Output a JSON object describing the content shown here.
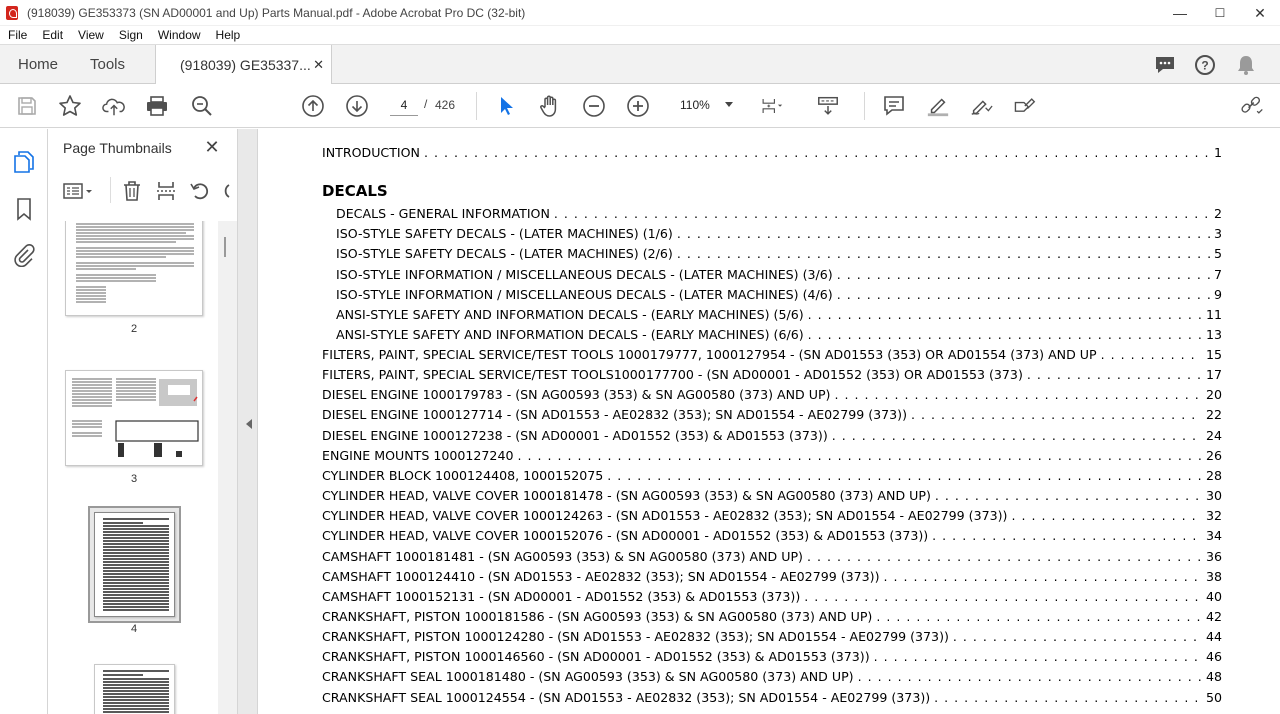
{
  "window": {
    "title": "(918039) GE353373 (SN AD00001 and Up) Parts Manual.pdf - Adobe Acrobat Pro DC (32-bit)",
    "minimize": "—",
    "maximize": "☐",
    "close": "✕"
  },
  "menu": [
    "File",
    "Edit",
    "View",
    "Sign",
    "Window",
    "Help"
  ],
  "tabs": {
    "home": "Home",
    "tools": "Tools",
    "document": "(918039) GE35337...",
    "document_close": "✕"
  },
  "toolbar": {
    "current_page": "4",
    "page_separator": "/",
    "total_pages": "426",
    "zoom": "110%"
  },
  "thumbnails": {
    "title": "Page Thumbnails",
    "close": "✕",
    "pages": [
      "2",
      "3",
      "4"
    ]
  },
  "toc": {
    "intro": {
      "title": "INTRODUCTION",
      "page": "1"
    },
    "section": "DECALS",
    "decal_entries": [
      {
        "title": "DECALS - GENERAL INFORMATION",
        "page": "2"
      },
      {
        "title": "ISO-STYLE SAFETY DECALS - (LATER MACHINES) (1/6)",
        "page": "3"
      },
      {
        "title": "ISO-STYLE SAFETY DECALS - (LATER MACHINES) (2/6)",
        "page": "5"
      },
      {
        "title": "ISO-STYLE INFORMATION / MISCELLANEOUS DECALS - (LATER MACHINES) (3/6)",
        "page": "7"
      },
      {
        "title": "ISO-STYLE INFORMATION / MISCELLANEOUS DECALS - (LATER MACHINES) (4/6)",
        "page": "9"
      },
      {
        "title": "ANSI-STYLE SAFETY AND INFORMATION DECALS - (EARLY MACHINES) (5/6)",
        "page": "11"
      },
      {
        "title": "ANSI-STYLE SAFETY AND INFORMATION DECALS - (EARLY MACHINES) (6/6)",
        "page": "13"
      }
    ],
    "entries": [
      {
        "title": "FILTERS, PAINT, SPECIAL SERVICE/TEST TOOLS 1000179777, 1000127954 - (SN AD01553 (353) OR AD01554 (373) AND UP",
        "page": "15"
      },
      {
        "title": "FILTERS, PAINT, SPECIAL SERVICE/TEST TOOLS1000177700 - (SN AD00001 - AD01552 (353) OR AD01553 (373)",
        "page": "17"
      },
      {
        "title": "DIESEL ENGINE 1000179783 - (SN AG00593 (353) & SN AG00580 (373) AND UP)",
        "page": "20"
      },
      {
        "title": "DIESEL ENGINE 1000127714 - (SN AD01553 - AE02832 (353); SN AD01554 - AE02799 (373))",
        "page": "22"
      },
      {
        "title": "DIESEL ENGINE 1000127238 - (SN AD00001 - AD01552 (353) & AD01553 (373))",
        "page": "24"
      },
      {
        "title": "ENGINE MOUNTS 1000127240",
        "page": "26"
      },
      {
        "title": "CYLINDER BLOCK 1000124408, 1000152075",
        "page": "28"
      },
      {
        "title": "CYLINDER HEAD, VALVE COVER 1000181478 - (SN AG00593 (353) & SN AG00580 (373) AND UP)",
        "page": "30"
      },
      {
        "title": "CYLINDER HEAD, VALVE COVER 1000124263 - (SN AD01553 - AE02832 (353); SN AD01554 - AE02799 (373))",
        "page": "32"
      },
      {
        "title": "CYLINDER HEAD, VALVE COVER 1000152076 - (SN AD00001 - AD01552 (353) & AD01553 (373))",
        "page": "34"
      },
      {
        "title": "CAMSHAFT 1000181481 - (SN AG00593 (353) & SN AG00580 (373) AND UP)",
        "page": "36"
      },
      {
        "title": "CAMSHAFT 1000124410 - (SN AD01553 - AE02832 (353); SN AD01554 - AE02799 (373))",
        "page": "38"
      },
      {
        "title": "CAMSHAFT 1000152131 - (SN AD00001 - AD01552 (353) & AD01553 (373))",
        "page": "40"
      },
      {
        "title": "CRANKSHAFT, PISTON 1000181586 - (SN AG00593 (353) & SN AG00580 (373) AND UP)",
        "page": "42"
      },
      {
        "title": "CRANKSHAFT, PISTON 1000124280 - (SN AD01553 - AE02832 (353); SN AD01554 - AE02799 (373))",
        "page": "44"
      },
      {
        "title": "CRANKSHAFT, PISTON 1000146560 - (SN AD00001 - AD01552 (353) & AD01553 (373))",
        "page": "46"
      },
      {
        "title": "CRANKSHAFT SEAL 1000181480 - (SN AG00593 (353) & SN AG00580 (373) AND UP)",
        "page": "48"
      },
      {
        "title": "CRANKSHAFT SEAL 1000124554 - (SN AD01553 - AE02832 (353); SN AD01554 - AE02799 (373))",
        "page": "50"
      }
    ]
  },
  "colors": {
    "acrobat_red": "#d3261d",
    "select_blue": "#1473e6",
    "icon_gray": "#505050"
  }
}
